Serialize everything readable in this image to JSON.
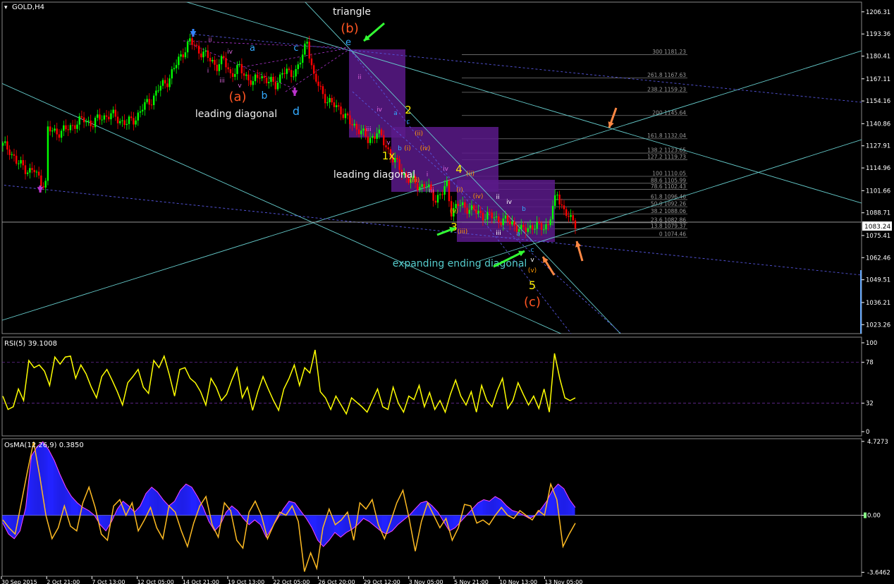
{
  "window": {
    "symbol_label": "GOLD,H4",
    "current_price": "1083.24"
  },
  "colors": {
    "background": "#000000",
    "grid_text": "#ffffff",
    "bull_candle": "#00ff00",
    "bear_candle": "#ff0000",
    "trendline": "#66cccc",
    "dashed_channel": "#5555dd",
    "wave_box": "#5a1a8a",
    "fib_line": "#777777",
    "rsi_line": "#ffff00",
    "osma_hist": "#2222ff",
    "osma_signal": "#ffbb22",
    "osma_outline": "#ff44ff",
    "arrow_green": "#33ff33",
    "arrow_orange": "#ff8844",
    "label_orange": "#ff5522",
    "label_cyan": "#33aaff",
    "label_yellow": "#ffee00",
    "label_white": "#eeeeee",
    "label_teal": "#55cccc"
  },
  "chart_data": [
    {
      "type": "candlestick",
      "title": "GOLD,H4",
      "y_axis_ticks": [
        "1206.31",
        "1193.36",
        "1180.41",
        "1167.11",
        "1154.16",
        "1140.86",
        "1127.91",
        "1114.96",
        "1101.66",
        "1088.71",
        "1075.41",
        "1062.46",
        "1049.51",
        "1036.21",
        "1023.26"
      ],
      "y_range": [
        1018,
        1212
      ],
      "x_axis_ticks": [
        "30 Sep 2015",
        "2 Oct 21:00",
        "7 Oct 13:00",
        "12 Oct 05:00",
        "14 Oct 21:00",
        "19 Oct 13:00",
        "22 Oct 05:00",
        "26 Oct 20:00",
        "29 Oct 12:00",
        "3 Nov 05:00",
        "5 Nov 21:00",
        "10 Nov 13:00",
        "13 Nov 05:00"
      ],
      "close_path": [
        [
          0,
          1128
        ],
        [
          3,
          1126
        ],
        [
          6,
          1118
        ],
        [
          9,
          1116
        ],
        [
          12,
          1113
        ],
        [
          14,
          1113
        ],
        [
          17,
          1107
        ],
        [
          19,
          1106
        ],
        [
          20,
          1137
        ],
        [
          24,
          1136
        ],
        [
          28,
          1137
        ],
        [
          32,
          1141
        ],
        [
          36,
          1143
        ],
        [
          40,
          1141
        ],
        [
          44,
          1145
        ],
        [
          48,
          1146
        ],
        [
          52,
          1143
        ],
        [
          55,
          1141
        ],
        [
          58,
          1143
        ],
        [
          62,
          1150
        ],
        [
          66,
          1155
        ],
        [
          69,
          1161
        ],
        [
          73,
          1166
        ],
        [
          76,
          1173
        ],
        [
          80,
          1183
        ],
        [
          83,
          1189
        ],
        [
          86,
          1185
        ],
        [
          89,
          1182
        ],
        [
          92,
          1178
        ],
        [
          95,
          1175
        ],
        [
          98,
          1178
        ],
        [
          101,
          1170
        ],
        [
          105,
          1173
        ],
        [
          108,
          1169
        ],
        [
          111,
          1164
        ],
        [
          114,
          1170
        ],
        [
          118,
          1165
        ],
        [
          121,
          1164
        ],
        [
          124,
          1171
        ],
        [
          127,
          1170
        ],
        [
          130,
          1172
        ],
        [
          133,
          1180
        ],
        [
          135,
          1190
        ],
        [
          138,
          1168
        ],
        [
          142,
          1158
        ],
        [
          146,
          1152
        ],
        [
          150,
          1149
        ],
        [
          154,
          1141
        ],
        [
          158,
          1138
        ],
        [
          162,
          1131
        ],
        [
          166,
          1136
        ],
        [
          170,
          1128
        ],
        [
          173,
          1120
        ],
        [
          176,
          1115
        ],
        [
          180,
          1108
        ],
        [
          184,
          1105
        ],
        [
          188,
          1104
        ],
        [
          192,
          1097
        ],
        [
          195,
          1100
        ],
        [
          197,
          1105
        ],
        [
          199,
          1090
        ],
        [
          202,
          1093
        ],
        [
          206,
          1092
        ],
        [
          210,
          1089
        ],
        [
          214,
          1087
        ],
        [
          218,
          1086
        ],
        [
          222,
          1084
        ],
        [
          226,
          1083
        ],
        [
          230,
          1078
        ],
        [
          234,
          1081
        ],
        [
          238,
          1080
        ],
        [
          242,
          1082
        ],
        [
          246,
          1100
        ],
        [
          249,
          1090
        ],
        [
          252,
          1084
        ],
        [
          254,
          1083
        ]
      ],
      "horizontal_level": 1083.24,
      "fibonacci_levels": [
        {
          "ratio": "300",
          "price": "1181.23"
        },
        {
          "ratio": "261.8",
          "price": "1167.63"
        },
        {
          "ratio": "238.2",
          "price": "1159.23"
        },
        {
          "ratio": "200",
          "price": "1145.64"
        },
        {
          "ratio": "161.8",
          "price": "1132.04"
        },
        {
          "ratio": "138.2",
          "price": "1123.65"
        },
        {
          "ratio": "127.2",
          "price": "1119.73"
        },
        {
          "ratio": "100",
          "price": "1110.05"
        },
        {
          "ratio": "88.6",
          "price": "1105.99"
        },
        {
          "ratio": "78.6",
          "price": "1102.43"
        },
        {
          "ratio": "61.8",
          "price": "1096.46"
        },
        {
          "ratio": "50.0",
          "price": "1092.26"
        },
        {
          "ratio": "38.2",
          "price": "1088.06"
        },
        {
          "ratio": "23.6",
          "price": "1082.86"
        },
        {
          "ratio": "13.8",
          "price": "1079.37"
        },
        {
          "ratio": "0",
          "price": "1074.46"
        }
      ],
      "annotations": [
        {
          "text": "triangle",
          "color": "label_white"
        },
        {
          "text": "(b)",
          "color": "label_orange"
        },
        {
          "text": "e",
          "color": "label_cyan"
        },
        {
          "text": "a",
          "color": "label_cyan"
        },
        {
          "text": "c",
          "color": "label_cyan"
        },
        {
          "text": "(a)",
          "color": "label_orange"
        },
        {
          "text": "b",
          "color": "label_cyan"
        },
        {
          "text": "d",
          "color": "label_cyan"
        },
        {
          "text": "leading diagonal",
          "color": "label_white"
        },
        {
          "text": "2",
          "color": "label_yellow"
        },
        {
          "text": "1x",
          "color": "label_yellow"
        },
        {
          "text": "leading diagonal",
          "color": "label_white"
        },
        {
          "text": "4",
          "color": "label_yellow"
        },
        {
          "text": "3",
          "color": "label_yellow"
        },
        {
          "text": "expanding ending diagonal",
          "color": "label_teal"
        },
        {
          "text": "5",
          "color": "label_yellow"
        },
        {
          "text": "(c)",
          "color": "label_orange"
        }
      ]
    },
    {
      "type": "line",
      "title": "RSI(5) 39.1008",
      "y_axis_ticks": [
        "100",
        "78",
        "32",
        "0"
      ],
      "ylim": [
        0,
        100
      ],
      "levels": [
        78,
        32
      ],
      "values": [
        40,
        25,
        28,
        48,
        35,
        80,
        72,
        75,
        68,
        52,
        84,
        76,
        84,
        85,
        60,
        75,
        65,
        50,
        38,
        62,
        70,
        58,
        45,
        30,
        55,
        62,
        70,
        50,
        43,
        80,
        72,
        85,
        64,
        40,
        70,
        72,
        60,
        55,
        45,
        30,
        60,
        50,
        35,
        42,
        58,
        72,
        38,
        50,
        24,
        45,
        62,
        48,
        35,
        24,
        48,
        60,
        75,
        52,
        72,
        66,
        92,
        45,
        38,
        25,
        40,
        30,
        20,
        38,
        33,
        28,
        22,
        35,
        48,
        28,
        25,
        50,
        32,
        22,
        40,
        36,
        52,
        28,
        44,
        25,
        35,
        22,
        42,
        58,
        40,
        30,
        45,
        22,
        52,
        35,
        28,
        46,
        60,
        26,
        35,
        55,
        42,
        30,
        40,
        26,
        48,
        22,
        88,
        60,
        38,
        35,
        38
      ]
    },
    {
      "type": "bar",
      "title": "OsMA(12,26,9) 0.3850",
      "y_axis_ticks": [
        "4.7273",
        "0.00",
        "-3.6462"
      ],
      "ylim": [
        -3.9,
        4.9
      ],
      "histogram": [
        -0.5,
        -1.2,
        -1.5,
        -1.0,
        0.5,
        3.8,
        4.4,
        4.7,
        4.2,
        3.5,
        2.6,
        1.8,
        1.2,
        0.8,
        0.5,
        0.3,
        0.0,
        -0.6,
        -1.0,
        -0.4,
        0.4,
        0.9,
        0.6,
        0.2,
        0.6,
        1.4,
        1.8,
        1.5,
        1.0,
        0.6,
        0.9,
        1.6,
        2.0,
        1.8,
        1.2,
        0.5,
        -0.4,
        -1.0,
        -0.6,
        0.2,
        0.6,
        0.3,
        -0.2,
        -0.6,
        -0.3,
        -0.6,
        -1.4,
        -0.8,
        -0.2,
        0.4,
        0.9,
        0.8,
        0.3,
        -0.2,
        -0.8,
        -1.6,
        -2.0,
        -1.6,
        -1.1,
        -1.4,
        -1.1,
        -0.9,
        -0.6,
        -0.2,
        -0.4,
        -0.7,
        -1.0,
        -1.2,
        -1.0,
        -0.6,
        -0.3,
        0.0,
        0.4,
        0.8,
        0.9,
        0.6,
        0.2,
        -0.4,
        -1.0,
        -0.8,
        -0.4,
        0.0,
        0.4,
        0.8,
        1.0,
        0.9,
        1.2,
        1.0,
        0.6,
        0.3,
        0.2,
        0.0,
        -0.2,
        0.0,
        0.4,
        0.9,
        1.6,
        2.0,
        1.7,
        1.0,
        0.5
      ],
      "signal": [
        -0.3,
        -0.8,
        -1.2,
        0.8,
        2.8,
        4.7,
        2.5,
        0.0,
        -1.5,
        -0.8,
        0.6,
        -0.7,
        -1.0,
        0.8,
        1.8,
        0.5,
        -1.2,
        -1.6,
        0.6,
        1.0,
        0.0,
        0.8,
        -1.0,
        -0.3,
        0.5,
        -0.8,
        -1.5,
        0.6,
        0.2,
        -1.0,
        -2.0,
        -0.5,
        0.6,
        1.2,
        -0.6,
        -1.4,
        0.8,
        0.3,
        -1.6,
        -2.1,
        0.2,
        0.9,
        0.0,
        -1.5,
        -0.6,
        0.2,
        0.0,
        0.6,
        -0.4,
        -3.6,
        -2.4,
        -3.4,
        -0.8,
        0.4,
        -0.6,
        -0.3,
        0.2,
        -1.6,
        0.8,
        0.4,
        1.0,
        -0.6,
        -1.5,
        -0.4,
        0.8,
        1.6,
        -0.2,
        -2.3,
        -0.4,
        0.8,
        0.0,
        -0.8,
        -0.2,
        -1.6,
        -0.8,
        0.7,
        0.6,
        -0.5,
        -0.3,
        -0.6,
        0.0,
        0.5,
        0.0,
        -0.2,
        0.3,
        0.0,
        -0.3,
        0.3,
        0.0,
        2.0,
        1.0,
        -2.0,
        -1.2,
        -0.5
      ]
    }
  ]
}
